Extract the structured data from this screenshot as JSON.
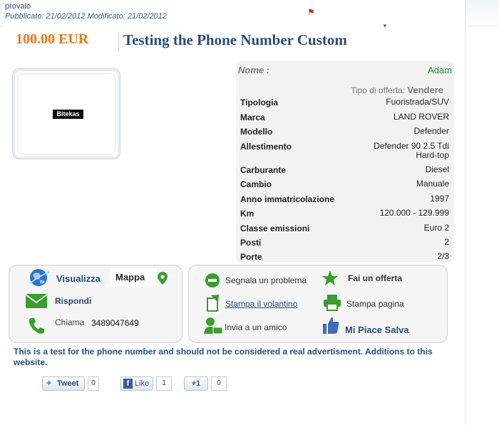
{
  "header": {
    "owner": "provalo",
    "dates": "Pubblicato: 21/02/2012 Modificato: 21/02/2012"
  },
  "listing": {
    "price": "100.00 EUR",
    "title": "Testing the Phone Number Custom",
    "logo_text": "Bitekas",
    "name_label": "Nome :",
    "name_value": "Adam",
    "offer_type_label": "Tipo di offerta:",
    "offer_type_value": "Vendere"
  },
  "specs": [
    {
      "label": "Tipologia",
      "value": "Fuoristrada/SUV"
    },
    {
      "label": "Marca",
      "value": "LAND ROVER"
    },
    {
      "label": "Modello",
      "value": "Defender"
    },
    {
      "label": "Allestimento",
      "value": "Defender 90 2.5 Tdi\nHard-top"
    },
    {
      "label": "Carburante",
      "value": "Diesel"
    },
    {
      "label": "Cambio",
      "value": "Manuale"
    },
    {
      "label": "Anno immatricolazione",
      "value": "1997"
    },
    {
      "label": "Km",
      "value": "120.000 - 129.999"
    },
    {
      "label": "Classe emissioni",
      "value": "Euro 2"
    },
    {
      "label": "Posti",
      "value": "2"
    },
    {
      "label": "Porte",
      "value": "2/3"
    }
  ],
  "contact": {
    "view_label": "Visualizza",
    "map_label": "Mappa",
    "reply_label": "Rispondi",
    "call_label": "Chiama",
    "phone": "3489047649"
  },
  "actions": {
    "report": "Segnala un problema",
    "offer": "Fai un offerta",
    "print_flyer": "Stampa il volantino",
    "print_page": "Stampa pagina",
    "send_friend": "Invia a un amico",
    "like_save": "Mi Piace Salva"
  },
  "description": "This is a test for the phone number and should not be considered a real advertisment. Additions to this website.",
  "social": {
    "tweet_label": "Tweet",
    "tweet_count": "0",
    "like_label": "Like",
    "like_count": "1",
    "plus_label": "+1",
    "plus_count": "0"
  },
  "colors": {
    "price": "#e8771c",
    "title": "#2c4b6e",
    "name_value": "#1e8e3e",
    "description": "#25517f"
  }
}
